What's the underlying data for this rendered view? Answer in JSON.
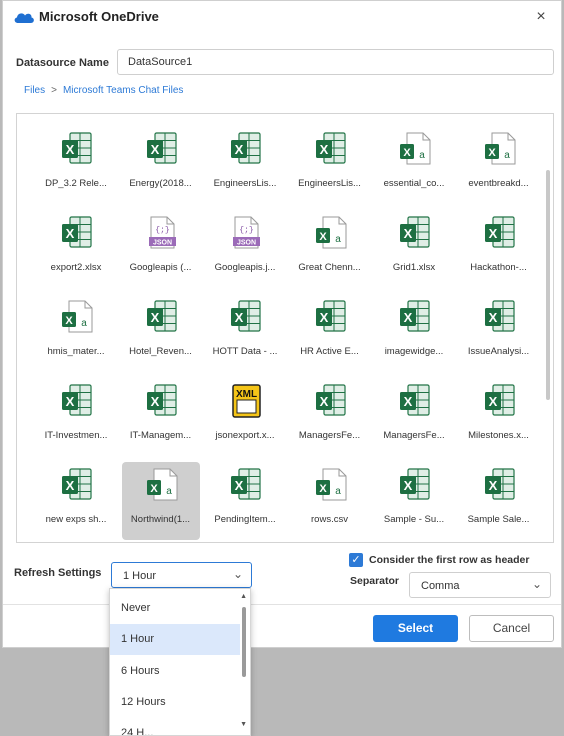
{
  "dialog": {
    "title": "Microsoft OneDrive",
    "close_glyph": "×",
    "icon": "onedrive-cloud-icon",
    "brand_color": "#1f7ae0"
  },
  "datasource": {
    "label": "Datasource Name",
    "value": "DataSource1"
  },
  "breadcrumb": {
    "items": [
      "Files",
      "Microsoft Teams Chat Files"
    ],
    "separator": ">"
  },
  "files": [
    {
      "name": "DP_3.2 Rele...",
      "type": "excel"
    },
    {
      "name": "Energy(2018...",
      "type": "excel"
    },
    {
      "name": "EngineersLis...",
      "type": "excel"
    },
    {
      "name": "EngineersLis...",
      "type": "excel"
    },
    {
      "name": "essential_co...",
      "type": "csv"
    },
    {
      "name": "eventbreakd...",
      "type": "csv"
    },
    {
      "name": "export2.xlsx",
      "type": "excel"
    },
    {
      "name": "Googleapis (...",
      "type": "json"
    },
    {
      "name": "Googleapis.j...",
      "type": "json"
    },
    {
      "name": "Great Chenn...",
      "type": "csv"
    },
    {
      "name": "Grid1.xlsx",
      "type": "excel"
    },
    {
      "name": "Hackathon-...",
      "type": "excel"
    },
    {
      "name": "hmis_mater...",
      "type": "csv"
    },
    {
      "name": "Hotel_Reven...",
      "type": "excel"
    },
    {
      "name": "HOTT Data - ...",
      "type": "excel"
    },
    {
      "name": "HR Active E...",
      "type": "excel"
    },
    {
      "name": "imagewidge...",
      "type": "excel"
    },
    {
      "name": "IssueAnalysi...",
      "type": "excel"
    },
    {
      "name": "IT-Investmen...",
      "type": "excel"
    },
    {
      "name": "IT-Managem...",
      "type": "excel"
    },
    {
      "name": "jsonexport.x...",
      "type": "xml"
    },
    {
      "name": "ManagersFe...",
      "type": "excel"
    },
    {
      "name": "ManagersFe...",
      "type": "excel"
    },
    {
      "name": "Milestones.x...",
      "type": "excel"
    },
    {
      "name": "new exps sh...",
      "type": "excel"
    },
    {
      "name": "Northwind(1...",
      "type": "csv",
      "selected": true
    },
    {
      "name": "PendingItem...",
      "type": "excel"
    },
    {
      "name": "rows.csv",
      "type": "csv"
    },
    {
      "name": "Sample - Su...",
      "type": "excel"
    },
    {
      "name": "Sample Sale...",
      "type": "excel"
    }
  ],
  "refresh": {
    "label": "Refresh Settings",
    "value": "1 Hour",
    "options": [
      "Never",
      "1 Hour",
      "6 Hours",
      "12 Hours",
      "24 H..."
    ],
    "active_option": "1 Hour"
  },
  "header_option": {
    "label": "Consider the first row as header",
    "checked": true
  },
  "separator": {
    "label": "Separator",
    "value": "Comma"
  },
  "buttons": {
    "select": "Select",
    "cancel": "Cancel"
  },
  "icon_glyphs": {
    "excel_letter": "X",
    "csv_letter": "a",
    "json_label": "JSON",
    "json_braces": "{;}",
    "xml_label": "XML",
    "xml_tag": "</>"
  }
}
